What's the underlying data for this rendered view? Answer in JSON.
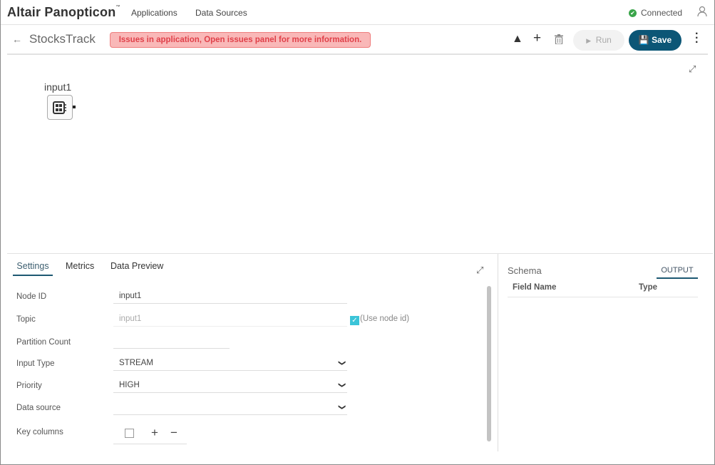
{
  "topbar": {
    "logo": "Altair Panopticon",
    "nav": [
      "Applications",
      "Data Sources"
    ],
    "status": "Connected"
  },
  "header": {
    "title": "StocksTrack",
    "banner": "Issues in application, Open issues panel for more information.",
    "run_label": "Run",
    "save_label": "Save"
  },
  "canvas": {
    "node_label": "input1"
  },
  "panel": {
    "tabs": [
      "Settings",
      "Metrics",
      "Data Preview"
    ],
    "fields": {
      "node_id": {
        "label": "Node ID",
        "value": "input1"
      },
      "topic": {
        "label": "Topic",
        "placeholder": "input1",
        "checkbox_label": "(Use node id)",
        "checked": true
      },
      "partition": {
        "label": "Partition Count",
        "value": ""
      },
      "input_type": {
        "label": "Input Type",
        "value": "STREAM"
      },
      "priority": {
        "label": "Priority",
        "value": "HIGH"
      },
      "data_source": {
        "label": "Data source",
        "value": ""
      },
      "key_columns": {
        "label": "Key columns"
      }
    }
  },
  "schema": {
    "title": "Schema",
    "tab": "OUTPUT",
    "columns": [
      "Field Name",
      "Type"
    ]
  },
  "colors": {
    "accent": "#0c5676",
    "error_bg": "#f9b8b8",
    "error_text": "#e0414a",
    "success": "#3aa54a",
    "check": "#3bc4d8"
  }
}
